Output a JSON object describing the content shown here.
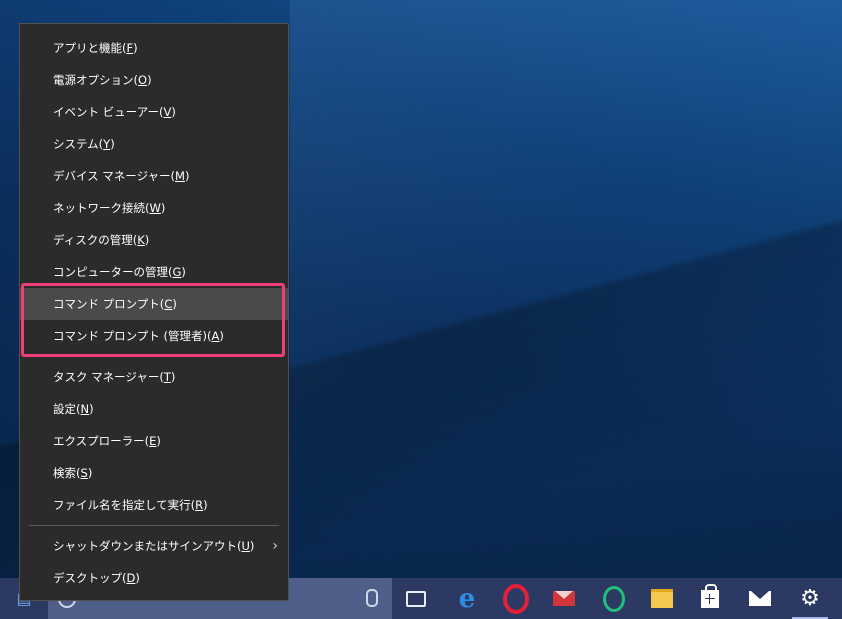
{
  "menu": {
    "items": [
      {
        "label": "アプリと機能(",
        "key": "F",
        "tail": ")"
      },
      {
        "label": "電源オプション(",
        "key": "O",
        "tail": ")"
      },
      {
        "label": "イベント ビューアー(",
        "key": "V",
        "tail": ")"
      },
      {
        "label": "システム(",
        "key": "Y",
        "tail": ")"
      },
      {
        "label": "デバイス マネージャー(",
        "key": "M",
        "tail": ")"
      },
      {
        "label": "ネットワーク接続(",
        "key": "W",
        "tail": ")"
      },
      {
        "label": "ディスクの管理(",
        "key": "K",
        "tail": ")"
      },
      {
        "label": "コンピューターの管理(",
        "key": "G",
        "tail": ")"
      },
      {
        "label": "コマンド プロンプト(",
        "key": "C",
        "tail": ")"
      },
      {
        "label": "コマンド プロンプト (管理者)(",
        "key": "A",
        "tail": ")"
      },
      {
        "label": "タスク マネージャー(",
        "key": "T",
        "tail": ")"
      },
      {
        "label": "設定(",
        "key": "N",
        "tail": ")"
      },
      {
        "label": "エクスプローラー(",
        "key": "E",
        "tail": ")"
      },
      {
        "label": "検索(",
        "key": "S",
        "tail": ")"
      },
      {
        "label": "ファイル名を指定して実行(",
        "key": "R",
        "tail": ")"
      },
      {
        "label": "シャットダウンまたはサインアウト(",
        "key": "U",
        "tail": ")"
      },
      {
        "label": "デスクトップ(",
        "key": "D",
        "tail": ")"
      }
    ],
    "submenu_arrow": "›"
  },
  "taskbar": {
    "start_glyph": "▤",
    "edge_glyph": "e",
    "gear_glyph": "⚙"
  },
  "colors": {
    "menu_bg": "#2b2b2b",
    "menu_hover": "#4a4a4a",
    "highlight_border": "#ee3f76",
    "taskbar_bg": "#2c3a63",
    "search_bg": "#4f5e89"
  }
}
